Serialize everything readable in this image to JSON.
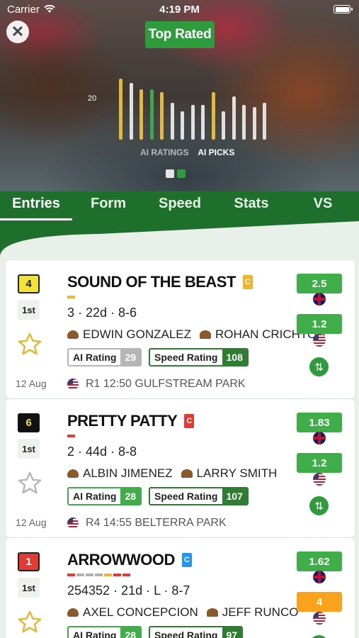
{
  "status": {
    "carrier": "Carrier",
    "time": "4:19 PM"
  },
  "header": {
    "badge": "Top Rated"
  },
  "chart_data": {
    "type": "bar",
    "y_tick": "20",
    "legend": [
      "AI RATINGS",
      "AI PICKS"
    ],
    "values": [
      28,
      26,
      23,
      23,
      22,
      17,
      13,
      16,
      16,
      22,
      13,
      20,
      16,
      15,
      17
    ],
    "colors": [
      "#e2b93b",
      "#e0e0e0",
      "#e2b93b",
      "#3ea64b",
      "#e2b93b",
      "#e0e0e0",
      "#e0e0e0",
      "#e0e0e0",
      "#e0e0e0",
      "#e2b93b",
      "#e0e0e0",
      "#e0e0e0",
      "#e0e0e0",
      "#e0e0e0",
      "#e0e0e0"
    ]
  },
  "pager": {
    "count": 2,
    "active": 1
  },
  "tabs": [
    "Entries",
    "Form",
    "Speed",
    "Stats",
    "VS"
  ],
  "runners": [
    {
      "num": "4",
      "num_bg": "#f5e332",
      "num_color": "#222",
      "num_border": "#222",
      "pos": "1st",
      "starred": true,
      "date": "12 Aug",
      "name": "SOUND OF THE BEAST",
      "class": "C",
      "class_color": "#f0b429",
      "form": [
        "#f0b429"
      ],
      "meta": "3 · 22d · 8-6",
      "jockey": "EDWIN GONZALEZ",
      "trainer": "ROHAN CRICHTON",
      "ai_label": "AI Rating",
      "ai_val": "29",
      "ai_color": "#b5b5b5",
      "speed_label": "Speed Rating",
      "speed_val": "108",
      "speed_color": "#2e7d32",
      "race": "R1  12:50  GULFSTREAM PARK",
      "odds_uk": "2.5",
      "odds_uk_color": "#3fae49",
      "odds_us": "1.2",
      "odds_us_color": "#3fae49"
    },
    {
      "num": "6",
      "num_bg": "#111",
      "num_color": "#f5e332",
      "num_border": "#111",
      "pos": "1st",
      "starred": false,
      "date": "12 Aug",
      "name": "PRETTY PATTY",
      "class": "C",
      "class_color": "#e53935",
      "form": [
        "#e53935"
      ],
      "meta": "2 · 44d · 8-8",
      "jockey": "ALBIN JIMENEZ",
      "trainer": "LARRY SMITH",
      "ai_label": "AI Rating",
      "ai_val": "28",
      "ai_color": "#3fae49",
      "speed_label": "Speed Rating",
      "speed_val": "107",
      "speed_color": "#2e7d32",
      "race": "R4  14:55  BELTERRA PARK",
      "odds_uk": "1.83",
      "odds_uk_color": "#3fae49",
      "odds_us": "1.2",
      "odds_us_color": "#3fae49"
    },
    {
      "num": "1",
      "num_bg": "#e53935",
      "num_color": "#fff",
      "num_border": "#222",
      "pos": "1st",
      "starred": true,
      "date": "",
      "name": "ARROWWOOD",
      "class": "C",
      "class_color": "#2196f3",
      "form": [
        "#e53935",
        "#b0b0b0",
        "#b0b0b0",
        "#b0b0b0",
        "#f0b429",
        "#e53935",
        "#e53935"
      ],
      "meta": "254352 · 21d · L · 8-7",
      "jockey": "AXEL CONCEPCION",
      "trainer": "JEFF RUNCO",
      "ai_label": "AI Rating",
      "ai_val": "28",
      "ai_color": "#3fae49",
      "speed_label": "Speed Rating",
      "speed_val": "97",
      "speed_color": "#2e7d32",
      "race": "",
      "odds_uk": "1.62",
      "odds_uk_color": "#3fae49",
      "odds_us": "4",
      "odds_us_color": "#f9a21b"
    }
  ]
}
